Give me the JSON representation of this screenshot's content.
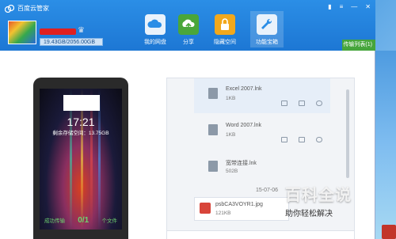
{
  "app": {
    "title": "百度云管家"
  },
  "account": {
    "quota": "19.43GB/2056.00GB"
  },
  "nav": [
    {
      "label": "我的网盘",
      "icon": "cloud-icon"
    },
    {
      "label": "分享",
      "icon": "share-icon"
    },
    {
      "label": "隐藏空间",
      "icon": "lock-icon"
    },
    {
      "label": "功能宝箱",
      "icon": "wrench-icon"
    }
  ],
  "transfer": {
    "label": "传输列表(1)"
  },
  "phone": {
    "time": "17:21",
    "remaining": "剩余存储空间：13.75GB",
    "success": "成功传输",
    "ratio": "0/1",
    "files": "个文件"
  },
  "files": [
    {
      "name": "Excel 2007.lnk",
      "size": "1KB"
    },
    {
      "name": "Word 2007.lnk",
      "size": "1KB"
    },
    {
      "name": "宽带连接.lnk",
      "size": "502B"
    }
  ],
  "date": "15-07-06",
  "image_file": {
    "name": "psbCA3VOYR1.jpg",
    "size": "121KB"
  },
  "watermark": {
    "big": "百科全说",
    "small": "助你轻松解决"
  },
  "colors": {
    "header": "#1d77d4",
    "accent_green": "#46a53b",
    "quota_bar": "#cfe3f7"
  }
}
